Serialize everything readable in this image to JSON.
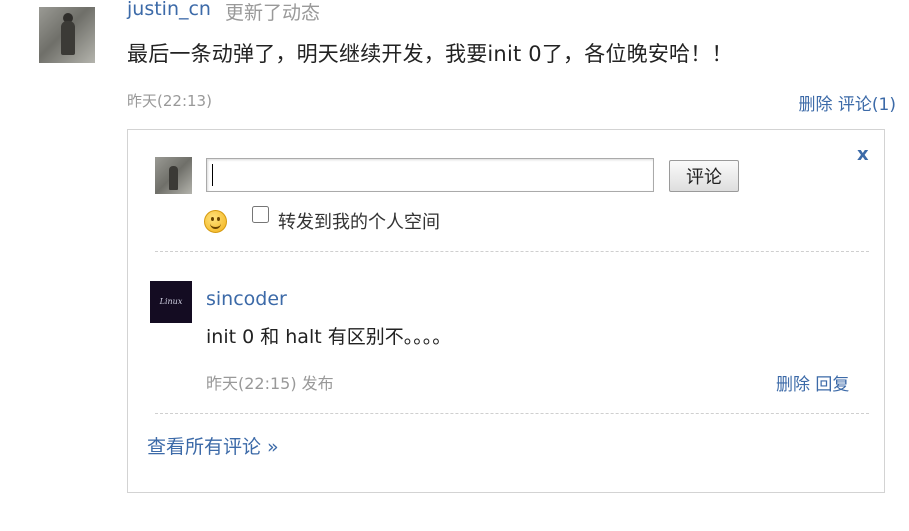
{
  "post": {
    "username": "justin_cn",
    "action": "更新了动态",
    "text": "最后一条动弹了，明天继续开发，我要init 0了，各位晚安哈！！",
    "time": "昨天(22:13)",
    "delete_label": "删除",
    "comment_count_label": "评论(1)"
  },
  "comment_box": {
    "close_label": "x",
    "input_value": "",
    "submit_label": "评论",
    "repost_label": "转发到我的个人空间",
    "repost_checked": false
  },
  "comment": {
    "username": "sincoder",
    "avatar_text": "Linux",
    "text": "init 0 和 halt 有区别不。。。。",
    "meta": "昨天(22:15) 发布",
    "delete_label": "删除",
    "reply_label": "回复"
  },
  "view_all_label": "查看所有评论 »",
  "colors": {
    "link": "#3c6aa8",
    "muted": "#999999",
    "border": "#d3d3d3"
  }
}
